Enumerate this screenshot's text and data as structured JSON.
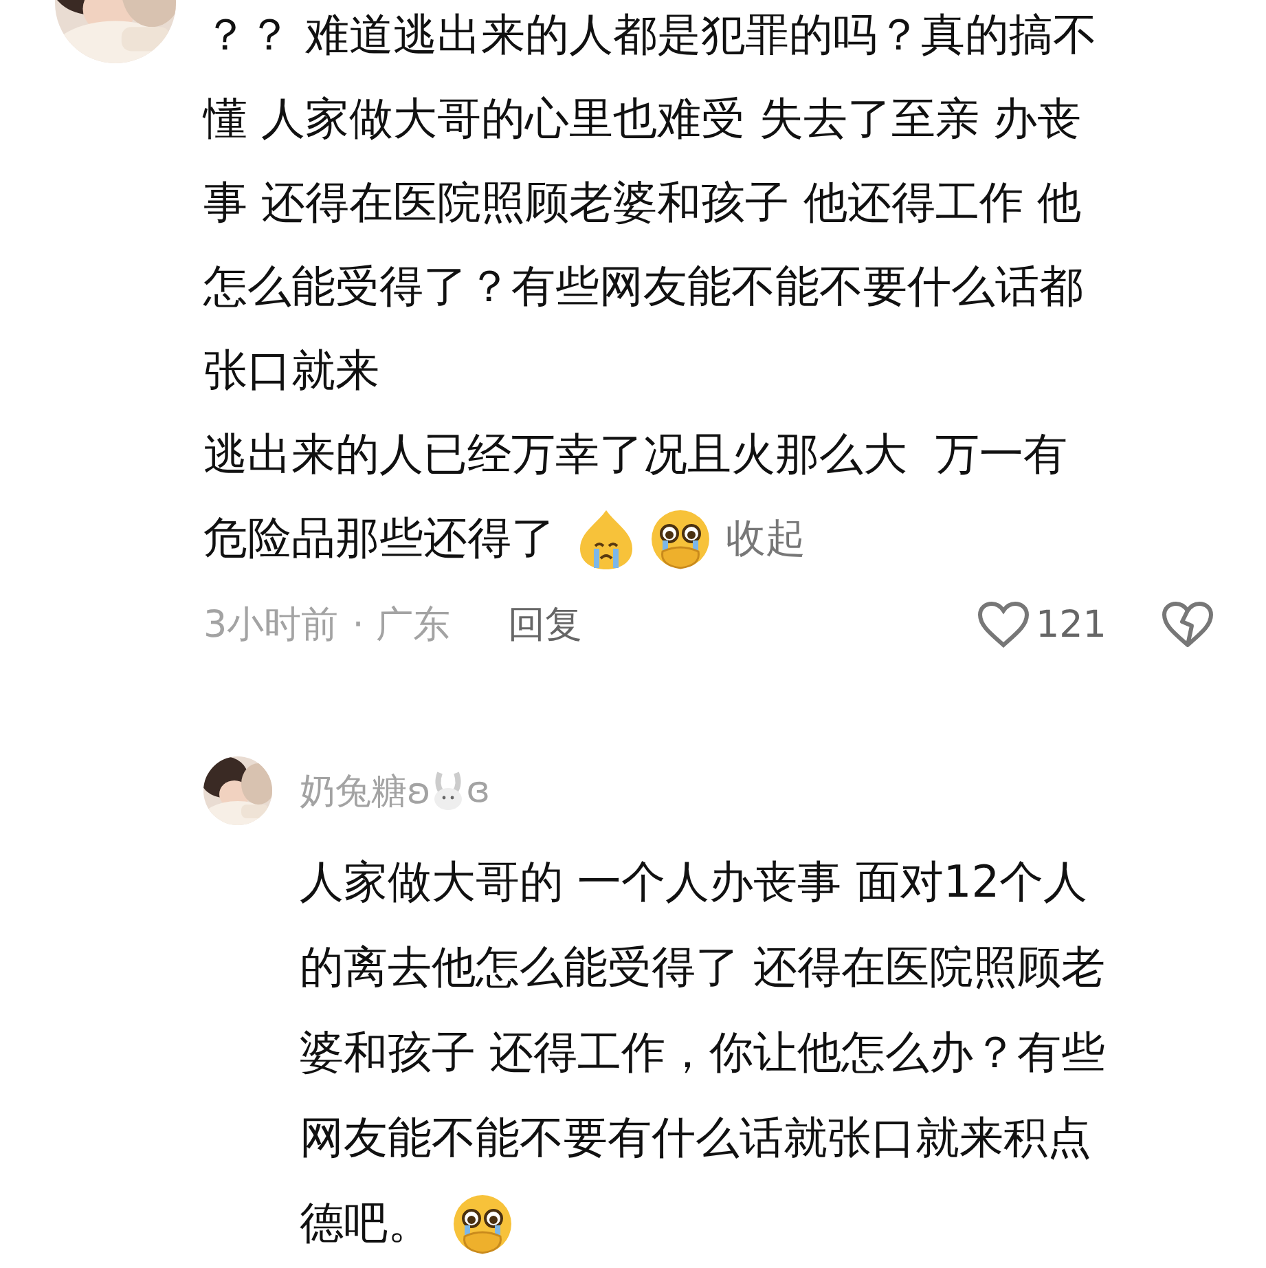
{
  "comment": {
    "paragraphs": [
      {
        "lines": [
          "？？ 难道逃出来的人都是犯罪的吗？真的搞不",
          "懂 人家做大哥的心里也难受 失去了至亲 办丧",
          "事 还得在医院照顾老婆和孩子 他还得工作 他",
          "怎么能受得了？有些网友能不能不要什么话都",
          "张口就来"
        ]
      },
      {
        "lines": [
          "逃出来的人已经万幸了况且火那么大  万一有",
          "危险品那些还得了"
        ],
        "emojis": [
          {
            "kind": "crying"
          },
          {
            "kind": "teary"
          }
        ]
      }
    ],
    "collapse_label": "收起",
    "time": "3小时前",
    "location": "· 广东",
    "reply_label": "回复",
    "likes": "121"
  },
  "reply": {
    "username": "奶兔糖ʚ",
    "username_suffix": "ɞ",
    "paragraphs": [
      {
        "lines": [
          "人家做大哥的 一个人办丧事 面对12个人",
          "的离去他怎么能受得了 还得在医院照顾老",
          "婆和孩子 还得工作，你让他怎么办？有些",
          "网友能不能不要有什么话就张口就来积点",
          "德吧。"
        ],
        "emojis": [
          {
            "kind": "teary"
          }
        ]
      }
    ]
  }
}
